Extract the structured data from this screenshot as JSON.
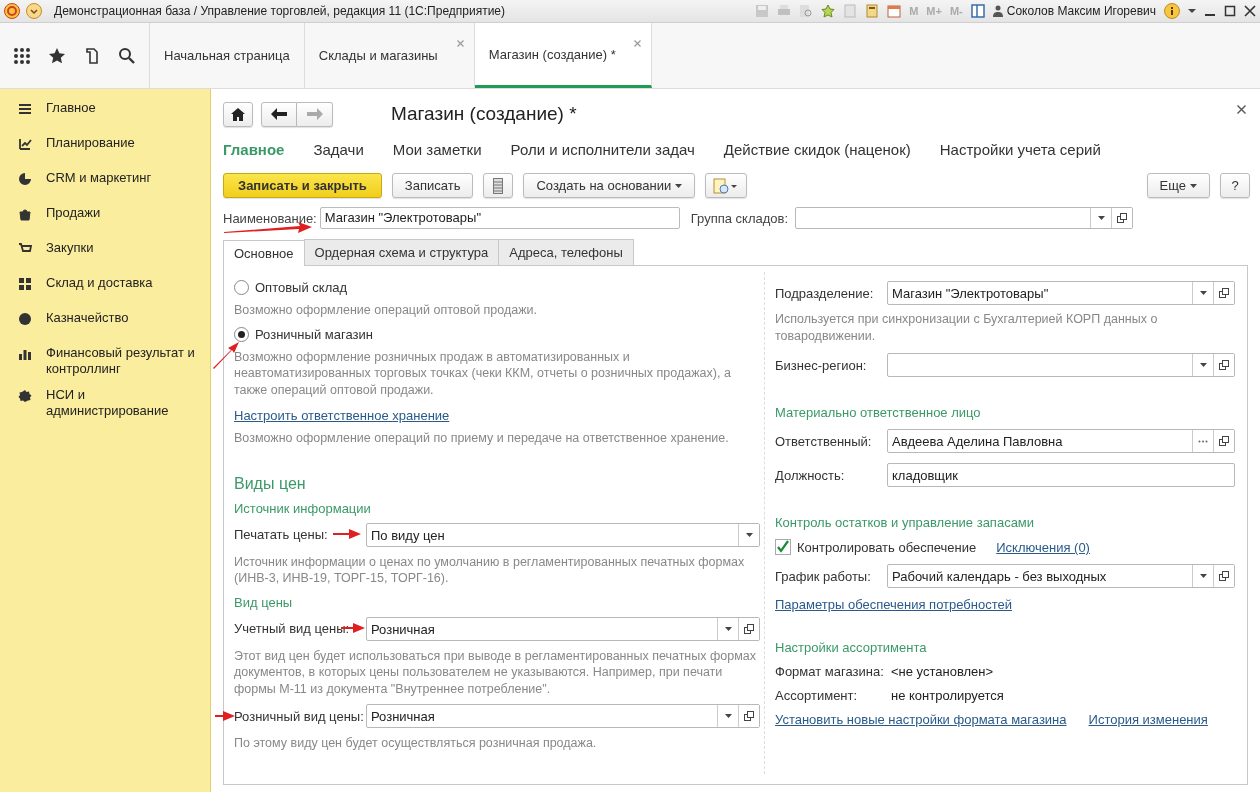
{
  "window": {
    "title": "Демонстрационная база / Управление торговлей, редакция 11  (1С:Предприятие)",
    "memory_buttons": [
      "M",
      "M+",
      "M-"
    ],
    "user": "Соколов Максим Игоревич"
  },
  "tabs": [
    {
      "label": "Начальная страница",
      "selected": false,
      "closable": false
    },
    {
      "label": "Склады и магазины",
      "selected": false,
      "closable": true
    },
    {
      "label": "Магазин (создание) *",
      "selected": true,
      "closable": true
    }
  ],
  "sidebar": {
    "items": [
      {
        "label": "Главное"
      },
      {
        "label": "Планирование"
      },
      {
        "label": "CRM и маркетинг"
      },
      {
        "label": "Продажи"
      },
      {
        "label": "Закупки"
      },
      {
        "label": "Склад и доставка"
      },
      {
        "label": "Казначейство"
      },
      {
        "label": "Финансовый результат и контроллинг"
      },
      {
        "label": "НСИ и администрирование"
      }
    ]
  },
  "form": {
    "title": "Магазин (создание) *",
    "nav": [
      {
        "label": "Главное",
        "selected": true
      },
      {
        "label": "Задачи",
        "selected": false
      },
      {
        "label": "Мои заметки",
        "selected": false
      },
      {
        "label": "Роли и исполнители задач",
        "selected": false
      },
      {
        "label": "Действие скидок (наценок)",
        "selected": false
      },
      {
        "label": "Настройки учета серий",
        "selected": false
      }
    ],
    "save_close_button": "Записать и закрыть",
    "save_button": "Записать",
    "create_based_button": "Создать на основании",
    "more_button": "Еще",
    "help_button": "?",
    "name_label": "Наименование:",
    "name_value": "Магазин \"Электротовары\"",
    "group_label": "Группа складов:",
    "tabs": [
      {
        "label": "Основное",
        "selected": true
      },
      {
        "label": "Ордерная схема и структура",
        "selected": false
      },
      {
        "label": "Адреса, телефоны",
        "selected": false
      }
    ],
    "left": [
      {
        "kind": "radio",
        "label": "Оптовый склад",
        "selected": false
      },
      {
        "kind": "note",
        "text": "Возможно оформление операций оптовой продажи."
      },
      {
        "kind": "radio",
        "label": "Розничный магазин",
        "selected": true
      },
      {
        "kind": "note",
        "text": "Возможно оформление розничных продаж в автоматизированных и неавтоматизированных торговых точках (чеки ККМ, отчеты о розничных продажах), а также операций оптовой продажи."
      },
      {
        "kind": "link",
        "text": "Настроить ответственное хранение"
      },
      {
        "kind": "note",
        "text": "Возможно оформление операций по приему и передаче на ответственное хранение."
      },
      {
        "kind": "heading",
        "text": "Виды цен"
      },
      {
        "kind": "subheading",
        "text": "Источник информации"
      },
      {
        "kind": "field",
        "label": "Печатать цены:",
        "value": "По виду цен",
        "dropdown": true,
        "open_button": false,
        "select_button": false
      },
      {
        "kind": "note",
        "text": "Источник информации о ценах по умолчанию в регламентированных печатных формах (ИНВ-3, ИНВ-19, ТОРГ-15, ТОРГ-16)."
      },
      {
        "kind": "subheading",
        "text": "Вид цены"
      },
      {
        "kind": "field",
        "label": "Учетный вид цены:",
        "value": "Розничная",
        "dropdown": true,
        "open_button": true,
        "select_button": false
      },
      {
        "kind": "note",
        "text": "Этот вид цен будет использоваться при выводе в регламентированных печатных формах документов, в которых цены пользователем не указываются. Например, при печати формы М-11 из документа \"Внутреннее потребление\"."
      },
      {
        "kind": "field",
        "label": "Розничный вид цены:",
        "value": "Розничная",
        "dropdown": true,
        "open_button": true,
        "select_button": false
      },
      {
        "kind": "note",
        "text": "По этому виду цен будет осуществляться розничная продажа."
      }
    ],
    "right": [
      {
        "kind": "field",
        "label": "Подразделение:",
        "value": "Магазин \"Электротовары\"",
        "dropdown": true,
        "open_button": true,
        "select_button": false
      },
      {
        "kind": "note",
        "text": "Используется при синхронизации с Бухгалтерией КОРП данных о товародвижении."
      },
      {
        "kind": "field",
        "label": "Бизнес-регион:",
        "dropdown": true,
        "open_button": true,
        "select_button": false
      },
      {
        "kind": "subheading",
        "text": "Материально ответственное лицо"
      },
      {
        "kind": "field",
        "label": "Ответственный:",
        "value": "Авдеева Аделина Павловна",
        "dropdown": false,
        "open_button": true,
        "select_button": true
      },
      {
        "kind": "field",
        "label": "Должность:",
        "value": "кладовщик",
        "dropdown": false,
        "open_button": false,
        "select_button": false
      },
      {
        "kind": "subheading",
        "text": "Контроль остатков и управление запасами"
      },
      {
        "kind": "checkbox",
        "label": "Контролировать обеспечение",
        "checked": true,
        "link": "Исключения (0)"
      },
      {
        "kind": "field",
        "label": "График работы:",
        "value": "Рабочий календарь - без выходных",
        "dropdown": true,
        "open_button": true,
        "select_button": false
      },
      {
        "kind": "link",
        "text": "Параметры обеспечения потребностей"
      },
      {
        "kind": "subheading",
        "text": "Настройки ассортимента"
      },
      {
        "kind": "pair",
        "label": "Формат магазина:",
        "value": "<не установлен>"
      },
      {
        "kind": "pair",
        "label": "Ассортимент:",
        "value": "не контролируется"
      },
      {
        "kind": "links",
        "items": [
          "Установить новые настройки формата магазина",
          "История изменения"
        ]
      }
    ]
  }
}
